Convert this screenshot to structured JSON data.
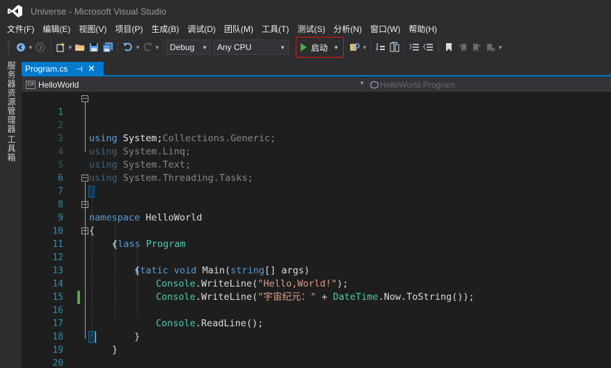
{
  "window": {
    "title": "Universe - Microsoft Visual Studio"
  },
  "menu": [
    {
      "label": "文件(F)"
    },
    {
      "label": "编辑(E)"
    },
    {
      "label": "视图(V)"
    },
    {
      "label": "项目(P)"
    },
    {
      "label": "生成(B)"
    },
    {
      "label": "调试(D)"
    },
    {
      "label": "团队(M)"
    },
    {
      "label": "工具(T)"
    },
    {
      "label": "测试(S)"
    },
    {
      "label": "分析(N)"
    },
    {
      "label": "窗口(W)"
    },
    {
      "label": "帮助(H)"
    }
  ],
  "toolbar": {
    "configuration": "Debug",
    "platform": "Any CPU",
    "start_label": "启动",
    "start_color": "#3bb34a",
    "highlight_color": "#e51400"
  },
  "side_tabs": {
    "server_explorer": "服务器资源管理器",
    "toolbox": "工具箱"
  },
  "document_tab": {
    "name": "Program.cs",
    "pin": "⊣",
    "close": "✕"
  },
  "navbar": {
    "left_icon": "C#",
    "left_text": "HelloWorld",
    "right_text": "HelloWorld.Program"
  },
  "editor": {
    "accent_color": "#007acc",
    "lines": [
      {
        "n": "1"
      },
      {
        "n": "2"
      },
      {
        "n": "3"
      },
      {
        "n": "4"
      },
      {
        "n": "5"
      },
      {
        "n": "6"
      },
      {
        "n": "7"
      },
      {
        "n": "8"
      },
      {
        "n": "9"
      },
      {
        "n": "10"
      },
      {
        "n": "11"
      },
      {
        "n": "12"
      },
      {
        "n": "13"
      },
      {
        "n": "14"
      },
      {
        "n": "15"
      },
      {
        "n": "16"
      },
      {
        "n": "17"
      },
      {
        "n": "18"
      },
      {
        "n": "19"
      },
      {
        "n": "20"
      }
    ],
    "code": {
      "l1_kw": "using",
      "l1_rest": " System;",
      "l2_kw": "using",
      "l2_rest": " System.Collections.Generic;",
      "l3_kw": "using",
      "l3_rest": " System.Linq;",
      "l4_kw": "using",
      "l4_rest": " System.Text;",
      "l5_kw": "using",
      "l5_rest": " System.Threading.Tasks;",
      "l7_kw": "namespace",
      "l7_rest": " HelloWorld",
      "l8": "{",
      "l9_kw": "class",
      "l9_type": "Program",
      "l10": "{",
      "l11_kw1": "static",
      "l11_kw2": "void",
      "l11_name": "Main(",
      "l11_kw3": "string",
      "l11_rest": "[] args)",
      "l12": "{",
      "l13_type": "Console",
      "l13_mid": ".WriteLine(",
      "l13_str": "\"Hello,World!\"",
      "l13_end": ");",
      "l14_type": "Console",
      "l14_mid": ".WriteLine(",
      "l14_str": "\"宇宙纪元：\"",
      "l14_plus": " + ",
      "l14_type2": "DateTime",
      "l14_end": ".Now.ToString());",
      "l16_type": "Console",
      "l16_end": ".ReadLine();",
      "l17": "}",
      "l18": "}",
      "l19": "}"
    }
  }
}
